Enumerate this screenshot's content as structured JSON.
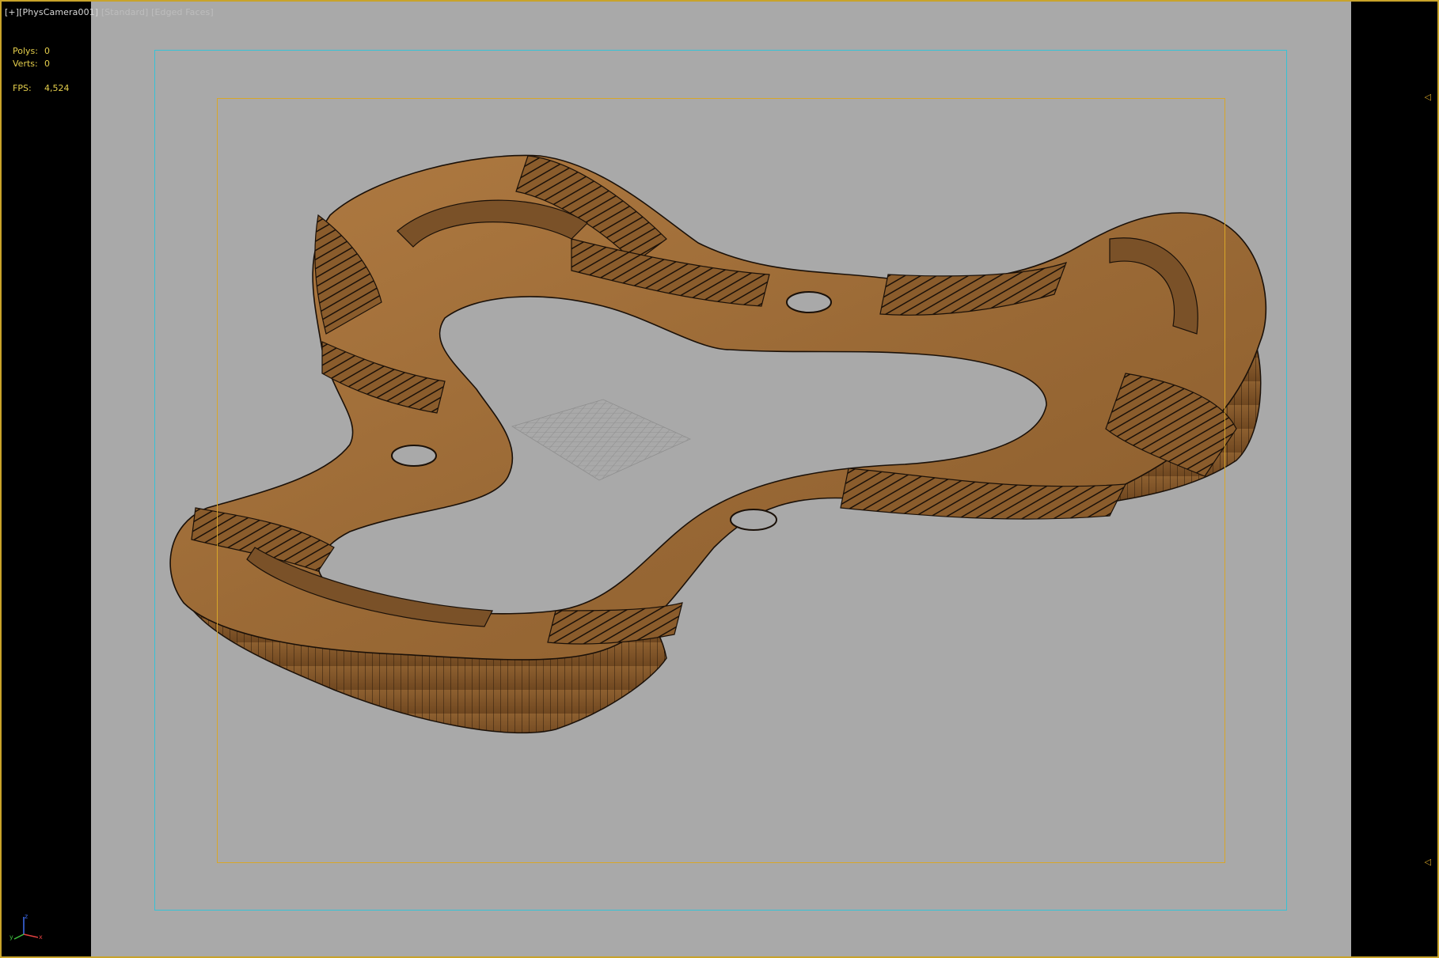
{
  "viewport": {
    "menu": {
      "plus": "[+]",
      "camera": "[PhysCamera001]",
      "shading": "[Standard]",
      "display": "[Edged Faces]"
    },
    "stats": {
      "polys_label": "Polys:",
      "polys_value": "0",
      "verts_label": "Verts:",
      "verts_value": "0",
      "fps_label": "FPS:",
      "fps_value": "4,524"
    },
    "markers": {
      "top": "◁",
      "bottom": "◁"
    },
    "colors": {
      "background": "#a9a9a9",
      "safe_frame": "#36c2d6",
      "action_frame": "#d8a629",
      "stats_text": "#e5cf4c",
      "wood": "#9a6a36"
    },
    "icons": [
      "xyz-axis-tripod-icon"
    ]
  }
}
